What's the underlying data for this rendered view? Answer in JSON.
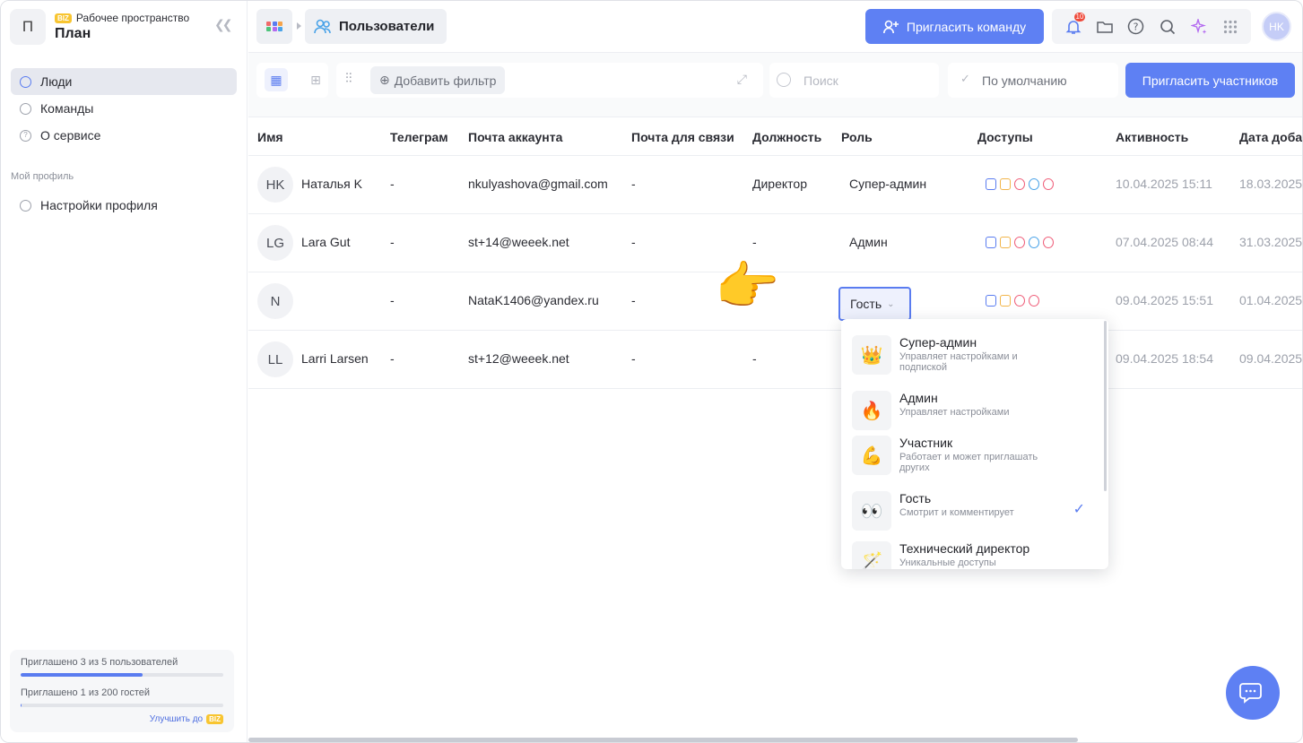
{
  "workspace": {
    "initial": "П",
    "subtitle": "Рабочее пространство",
    "badge": "BIZ",
    "name": "План"
  },
  "sidebar": {
    "items": [
      {
        "label": "Люди"
      },
      {
        "label": "Команды"
      },
      {
        "label": "О сервисе"
      }
    ],
    "section_title": "Мой профиль",
    "profile_items": [
      {
        "label": "Настройки профиля"
      }
    ]
  },
  "quota": {
    "users_label": "Приглашено 3 из 5 пользователей",
    "users_progress": 0.6,
    "guests_label": "Приглашено 1 из 200 гостей",
    "guests_progress": 0.005,
    "upgrade_label": "Улучшить до",
    "upgrade_badge": "BIZ"
  },
  "header": {
    "breadcrumb": "Пользователи",
    "invite_team": "Пригласить команду",
    "notifications_count": "10",
    "user_initials": "HK"
  },
  "toolbar": {
    "add_filter": "Добавить фильтр",
    "search_placeholder": "Поиск",
    "sort_label": "По умолчанию",
    "invite_participants": "Пригласить участников"
  },
  "table": {
    "columns": [
      "Имя",
      "Телеграм",
      "Почта аккаунта",
      "Почта для связи",
      "Должность",
      "Роль",
      "Доступы",
      "Активность",
      "Дата доба"
    ],
    "rows": [
      {
        "initials": "HK",
        "name": "Наталья K",
        "telegram": "-",
        "email": "nkulyashova@gmail.com",
        "contact": "-",
        "position": "Директор",
        "role": "Супер-админ",
        "activity": "10.04.2025 15:11",
        "date": "18.03.2025"
      },
      {
        "initials": "LG",
        "name": "Lara Gut",
        "telegram": "-",
        "email": "st+14@weeek.net",
        "contact": "-",
        "position": "-",
        "role": "Админ",
        "activity": "07.04.2025 08:44",
        "date": "31.03.2025"
      },
      {
        "initials": "N",
        "name": "",
        "telegram": "-",
        "email": "NataK1406@yandex.ru",
        "contact": "-",
        "position": "",
        "role": "Гость",
        "activity": "09.04.2025 15:51",
        "date": "01.04.2025"
      },
      {
        "initials": "LL",
        "name": "Larri Larsen",
        "telegram": "-",
        "email": "st+12@weeek.net",
        "contact": "-",
        "position": "-",
        "role": "",
        "activity": "09.04.2025 18:54",
        "date": "09.04.2025"
      }
    ]
  },
  "role_dropdown": {
    "options": [
      {
        "icon": "👑",
        "title": "Супер-админ",
        "desc": "Управляет настройками и подпиской"
      },
      {
        "icon": "🔥",
        "title": "Админ",
        "desc": "Управляет настройками"
      },
      {
        "icon": "💪",
        "title": "Участник",
        "desc": "Работает и может приглашать других"
      },
      {
        "icon": "👀",
        "title": "Гость",
        "desc": "Смотрит и комментирует",
        "selected": true
      },
      {
        "icon": "🪄",
        "title": "Технический директор",
        "desc": "Уникальные доступы"
      }
    ]
  },
  "pointer_icon": "👉",
  "colors": {
    "accent": "#5e80f3",
    "badge": "#f8c531",
    "notification": "#ef4a3b"
  }
}
